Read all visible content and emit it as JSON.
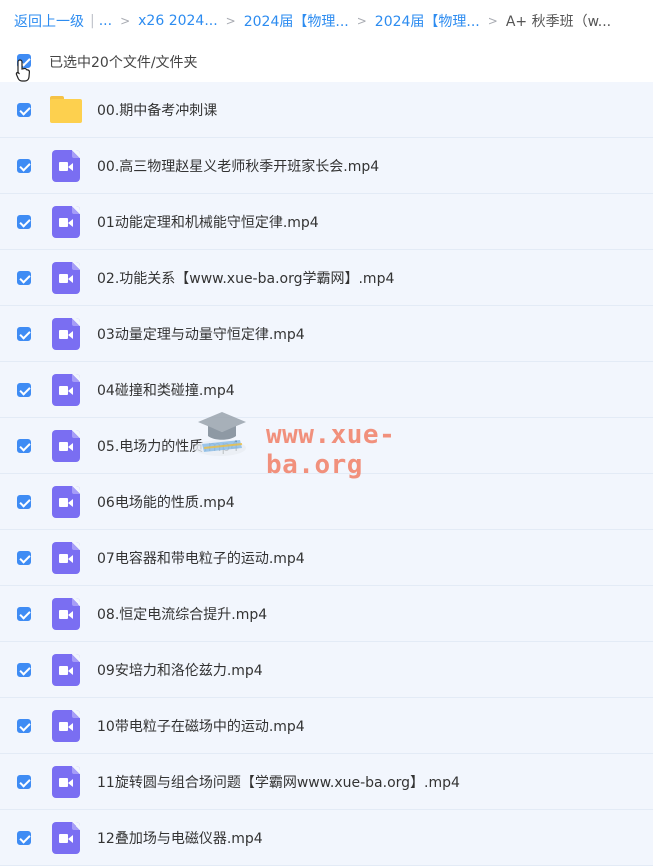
{
  "breadcrumb": {
    "back_label": "返回上一级",
    "pipe": "|",
    "ellipsis": "...",
    "separator": ">",
    "items": [
      "x26 2024...",
      "2024届【物理...",
      "2024届【物理..."
    ],
    "current": "A+ 秋季班（w..."
  },
  "selection": {
    "text": "已选中20个文件/文件夹",
    "checked": true
  },
  "files": [
    {
      "type": "folder",
      "name": "00.期中备考冲刺课",
      "checked": true
    },
    {
      "type": "video",
      "name": "00.高三物理赵星义老师秋季开班家长会.mp4",
      "checked": true
    },
    {
      "type": "video",
      "name": "01动能定理和机械能守恒定律.mp4",
      "checked": true
    },
    {
      "type": "video",
      "name": "02.功能关系【www.xue-ba.org学霸网】.mp4",
      "checked": true
    },
    {
      "type": "video",
      "name": "03动量定理与动量守恒定律.mp4",
      "checked": true
    },
    {
      "type": "video",
      "name": "04碰撞和类碰撞.mp4",
      "checked": true
    },
    {
      "type": "video",
      "name": "05.电场力的性质.mp4",
      "checked": true
    },
    {
      "type": "video",
      "name": "06电场能的性质.mp4",
      "checked": true
    },
    {
      "type": "video",
      "name": "07电容器和带电粒子的运动.mp4",
      "checked": true
    },
    {
      "type": "video",
      "name": "08.恒定电流综合提升.mp4",
      "checked": true
    },
    {
      "type": "video",
      "name": "09安培力和洛伦兹力.mp4",
      "checked": true
    },
    {
      "type": "video",
      "name": "10带电粒子在磁场中的运动.mp4",
      "checked": true
    },
    {
      "type": "video",
      "name": "11旋转圆与组合场问题【学霸网www.xue-ba.org】.mp4",
      "checked": true
    },
    {
      "type": "video",
      "name": "12叠加场与电磁仪器.mp4",
      "checked": true
    }
  ],
  "watermark": {
    "text": "www.xue-ba.org",
    "icon": "graduation-cap-icon"
  },
  "colors": {
    "accent": "#3f8cf4",
    "link": "#2d8cf0",
    "row_bg": "#f2f6fd",
    "folder": "#fdd04e",
    "video": "#7a6ef2"
  }
}
